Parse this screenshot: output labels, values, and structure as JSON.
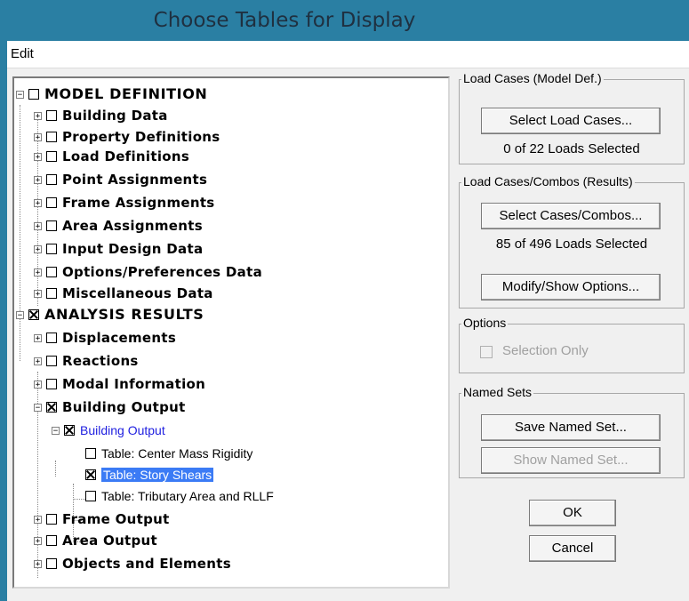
{
  "window": {
    "title": "Choose Tables for Display"
  },
  "menu": {
    "edit": "Edit"
  },
  "tree": {
    "model_definition": "MODEL DEFINITION",
    "building_data": "Building Data",
    "property_definitions": "Property Definitions",
    "load_definitions": "Load Definitions",
    "point_assignments": "Point Assignments",
    "frame_assignments": "Frame Assignments",
    "area_assignments": "Area Assignments",
    "input_design_data": "Input Design Data",
    "options_preferences": "Options/Preferences Data",
    "miscellaneous_data": "Miscellaneous Data",
    "analysis_results": "ANALYSIS RESULTS",
    "displacements": "Displacements",
    "reactions": "Reactions",
    "modal_information": "Modal Information",
    "building_output": "Building Output",
    "building_output_sub": "Building Output",
    "table_center_mass": "Table:  Center Mass Rigidity",
    "table_story_shears": "Table:  Story Shears",
    "table_tributary": "Table:  Tributary Area and RLLF",
    "frame_output": "Frame Output",
    "area_output": "Area Output",
    "objects_elements": "Objects and Elements"
  },
  "load_cases": {
    "title": "Load Cases (Model Def.)",
    "button": "Select Load Cases...",
    "status": "0  of  22  Loads Selected"
  },
  "load_combos": {
    "title": "Load Cases/Combos (Results)",
    "button": "Select Cases/Combos...",
    "status": "85  of  496  Loads Selected",
    "modify_button": "Modify/Show Options..."
  },
  "options": {
    "title": "Options",
    "selection_only": "Selection Only"
  },
  "named_sets": {
    "title": "Named Sets",
    "save_button": "Save Named Set...",
    "show_button": "Show Named Set..."
  },
  "actions": {
    "ok": "OK",
    "cancel": "Cancel"
  }
}
